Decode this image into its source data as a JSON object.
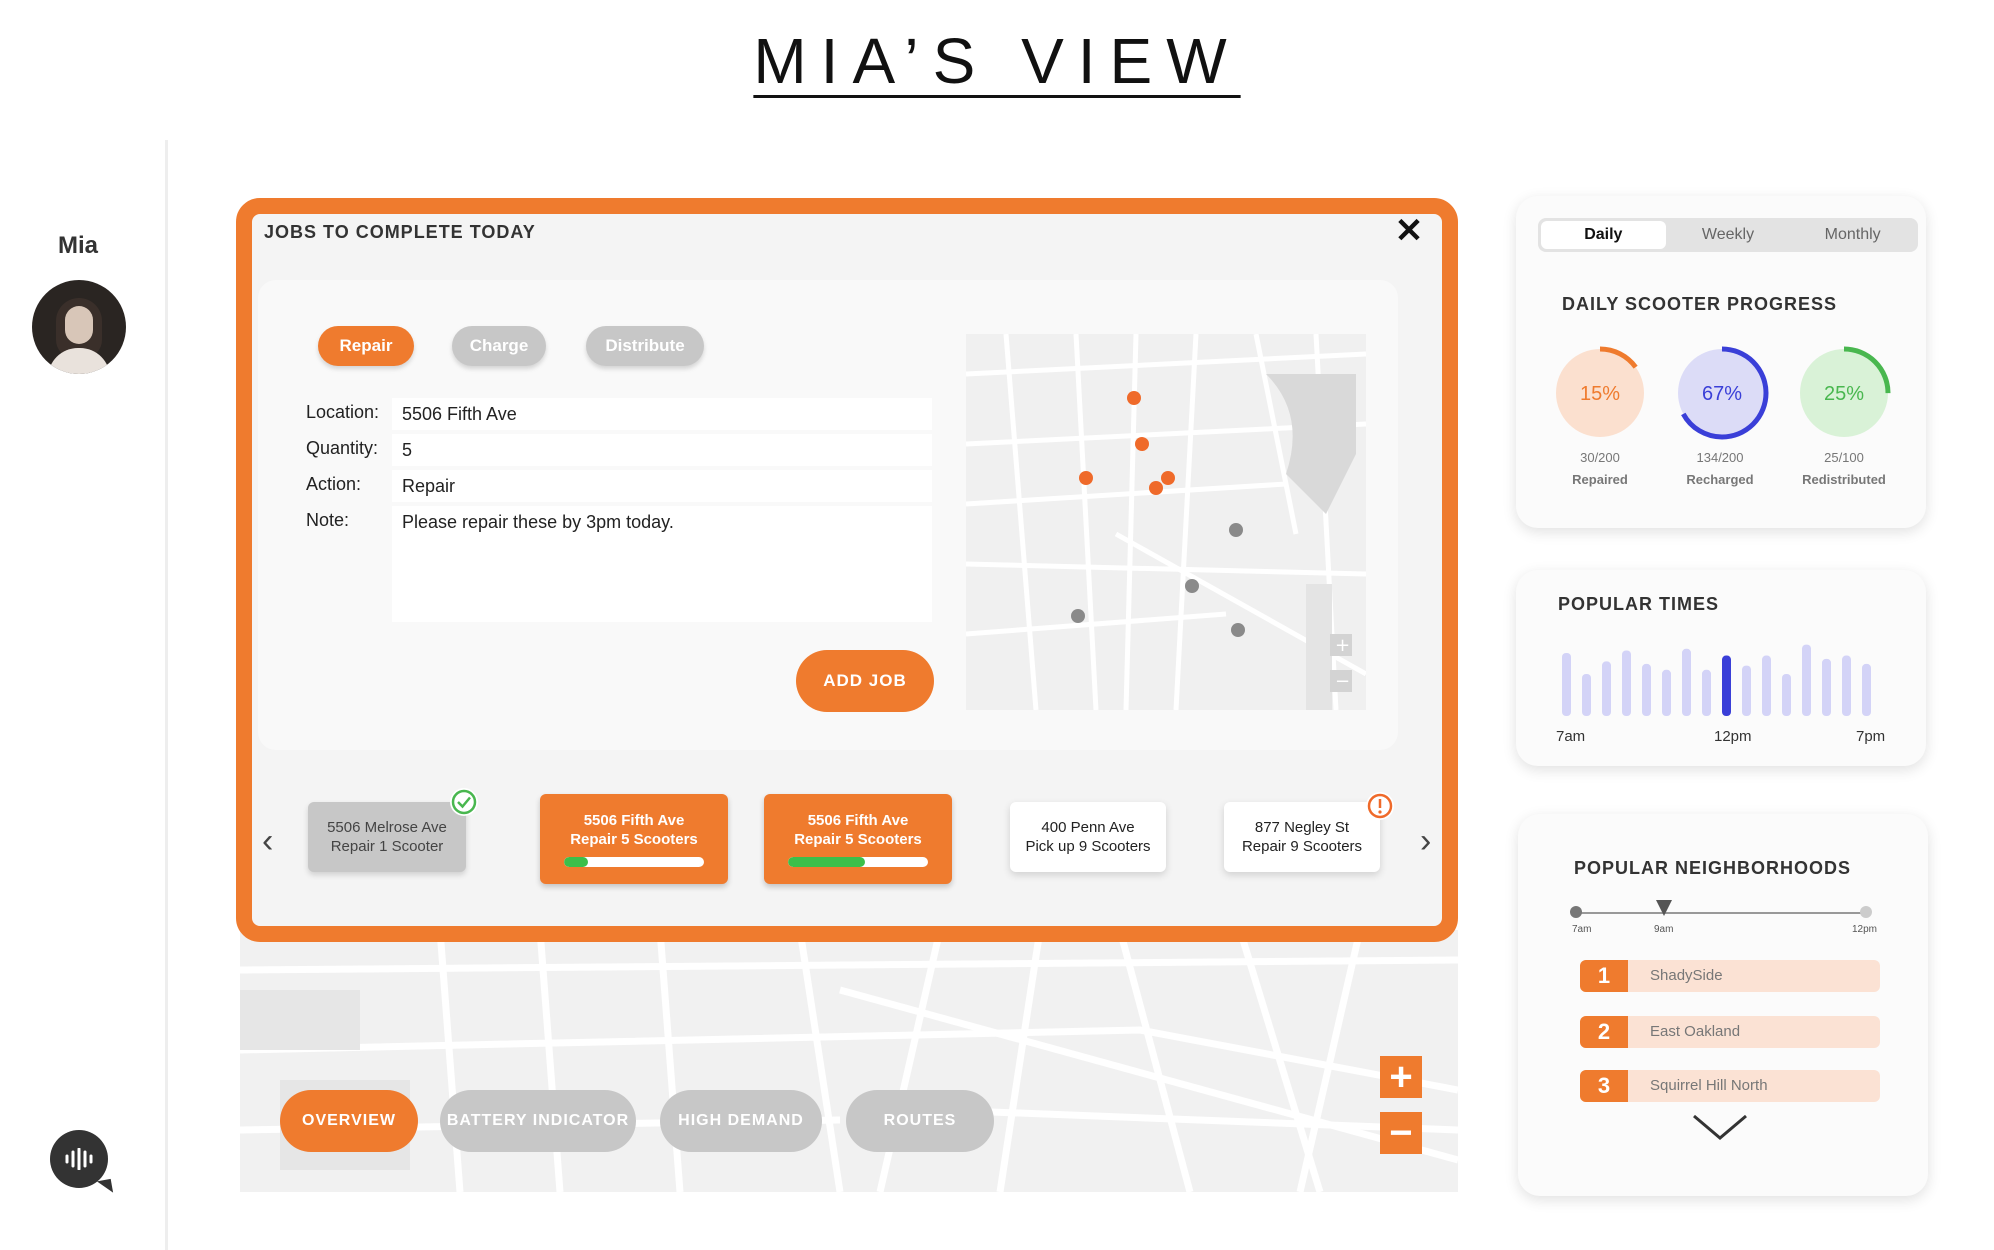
{
  "page": {
    "title": "MIA’S VIEW"
  },
  "user": {
    "name": "Mia",
    "avatar": "user-avatar",
    "voice_icon": "voice-assistant-icon"
  },
  "modes": [
    {
      "label": "OVERVIEW",
      "active": true
    },
    {
      "label": "BATTERY INDICATOR",
      "active": false
    },
    {
      "label": "HIGH DEMAND",
      "active": false
    },
    {
      "label": "ROUTES",
      "active": false
    }
  ],
  "jobs": {
    "title": "JOBS TO COMPLETE TODAY",
    "tabs": [
      {
        "label": "Repair",
        "active": true
      },
      {
        "label": "Charge",
        "active": false
      },
      {
        "label": "Distribute",
        "active": false
      }
    ],
    "form": {
      "location_label": "Location:",
      "location_value": "5506 Fifth Ave",
      "quantity_label": "Quantity:",
      "quantity_value": "5",
      "action_label": "Action:",
      "action_value": "Repair",
      "note_label": "Note:",
      "note_value": "Please repair these by 3pm today."
    },
    "add_job": "ADD JOB",
    "queue": [
      {
        "line1": "5506 Melrose Ave",
        "line2": "Repair 1 Scooter",
        "status": "done"
      },
      {
        "line1": "5506 Fifth Ave",
        "line2": "Repair 5 Scooters",
        "status": "active",
        "progress": 0.17
      },
      {
        "line1": "5506 Fifth Ave",
        "line2": "Repair 5 Scooters",
        "status": "active",
        "progress": 0.55
      },
      {
        "line1": "400 Penn Ave",
        "line2": "Pick up 9 Scooters",
        "status": "pending"
      },
      {
        "line1": "877 Negley St",
        "line2": "Repair 9 Scooters",
        "status": "pending",
        "alert": true
      }
    ]
  },
  "stats": {
    "periods": [
      {
        "label": "Daily",
        "active": true
      },
      {
        "label": "Weekly",
        "active": false
      },
      {
        "label": "Monthly",
        "active": false
      }
    ],
    "progress_title": "DAILY SCOOTER PROGRESS",
    "rings": [
      {
        "pct": "15%",
        "fraction": "30/200",
        "label": "Repaired",
        "value": 0.15,
        "color": "#ef7b2e",
        "fill": "#fbe0cf"
      },
      {
        "pct": "67%",
        "fraction": "134/200",
        "label": "Recharged",
        "value": 0.67,
        "color": "#3a3fd8",
        "fill": "#dcdcf7"
      },
      {
        "pct": "25%",
        "fraction": "25/100",
        "label": "Redistributed",
        "value": 0.25,
        "color": "#49b74f",
        "fill": "#d9f2d7"
      }
    ]
  },
  "popular_times": {
    "title": "POPULAR TIMES",
    "labels": [
      "7am",
      "12pm",
      "7pm"
    ],
    "bars": [
      0.75,
      0.5,
      0.65,
      0.78,
      0.62,
      0.55,
      0.8,
      0.55,
      0.72,
      0.6,
      0.72,
      0.5,
      0.85,
      0.68,
      0.72,
      0.62
    ],
    "highlight_index": 8,
    "bar_color": "#d3d3f7",
    "highlight_color": "#3a3fd8"
  },
  "neighborhoods": {
    "title": "POPULAR NEIGHBORHOODS",
    "timeline": [
      "7am",
      "9am",
      "12pm"
    ],
    "items": [
      {
        "rank": "1",
        "name": "ShadySide"
      },
      {
        "rank": "2",
        "name": "East Oakland"
      },
      {
        "rank": "3",
        "name": "Squirrel Hill North"
      }
    ]
  }
}
